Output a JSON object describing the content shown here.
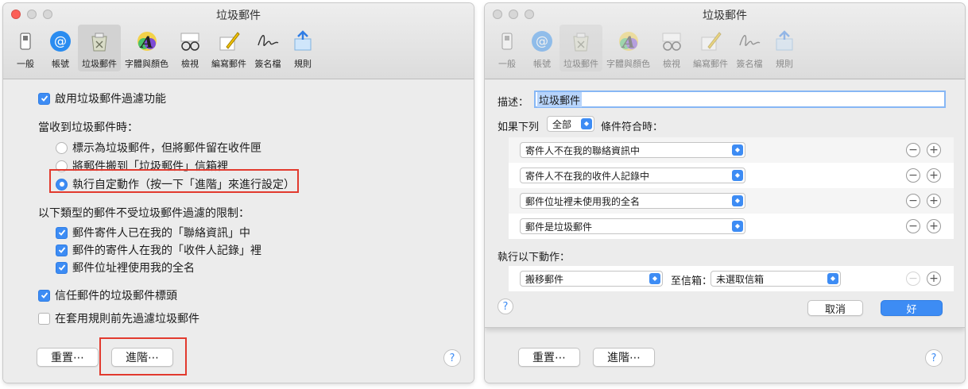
{
  "window_title": "垃圾郵件",
  "toolbar": {
    "items": [
      {
        "label": "一般",
        "icon": "switch-icon"
      },
      {
        "label": "帳號",
        "icon": "at-sign-icon"
      },
      {
        "label": "垃圾郵件",
        "icon": "junk-mail-trash-icon"
      },
      {
        "label": "字體與顏色",
        "icon": "font-color-icon"
      },
      {
        "label": "檢視",
        "icon": "glasses-icon"
      },
      {
        "label": "編寫郵件",
        "icon": "pencil-icon"
      },
      {
        "label": "簽名檔",
        "icon": "signature-icon"
      },
      {
        "label": "規則",
        "icon": "rules-icon"
      }
    ]
  },
  "left": {
    "enable_filter": "啟用垃圾郵件過濾功能",
    "when_received": "當收到垃圾郵件時：",
    "radio_options": [
      "標示為垃圾郵件，但將郵件留在收件匣",
      "將郵件搬到「垃圾郵件」信箱裡",
      "執行自定動作（按一下「進階」來進行設定）"
    ],
    "exempt_heading": "以下類型的郵件不受垃圾郵件過濾的限制：",
    "exempt_options": [
      "郵件寄件人已在我的「聯絡資訊」中",
      "郵件的寄件人在我的「收件人記錄」裡",
      "郵件位址裡使用我的全名"
    ],
    "trust_headers": "信任郵件的垃圾郵件標頭",
    "filter_before_rules": "在套用規則前先過濾垃圾郵件",
    "reset_button": "重置⋯",
    "advanced_button": "進階⋯",
    "help": "?"
  },
  "right": {
    "description_label": "描述：",
    "description_value": "垃圾郵件",
    "if_label": "如果下列",
    "match_select": "全部",
    "conditions_label": "條件符合時：",
    "conditions": [
      "寄件人不在我的聯絡資訊中",
      "寄件人不在我的收件人記錄中",
      "郵件位址裡未使用我的全名",
      "郵件是垃圾郵件"
    ],
    "actions_label": "執行以下動作：",
    "action_select": "搬移郵件",
    "to_mailbox_label": "至信箱：",
    "mailbox_select": "未選取信箱",
    "cancel_button": "取消",
    "ok_button": "好",
    "reset_button": "重置⋯",
    "advanced_button": "進階⋯",
    "help": "?",
    "minus": "−",
    "plus": "+"
  },
  "colors": {
    "accent": "#3d8cf4",
    "highlight": "#e23a2e"
  }
}
